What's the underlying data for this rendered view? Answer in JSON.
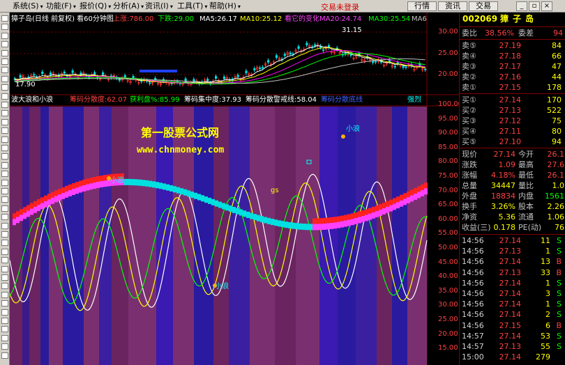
{
  "menubar": {
    "items": [
      {
        "label": "系统(S)"
      },
      {
        "label": "功能(F)"
      },
      {
        "label": "报价(Q)"
      },
      {
        "label": "分析(A)"
      },
      {
        "label": "资讯(I)"
      },
      {
        "label": "工具(T)"
      },
      {
        "label": "帮助(H)"
      }
    ],
    "account_status": "交易未登录",
    "buttons": [
      "行情",
      "资讯",
      "交易"
    ],
    "window_controls": [
      "minimize-icon",
      "restore-icon",
      "close-icon"
    ]
  },
  "colors": {
    "up": "#ff3030",
    "down": "#00e0e0",
    "ma5": "#ffffff",
    "ma10": "#ffff00",
    "ma20": "#ff00ff",
    "ma30": "#00ff00",
    "ma60": "#c0c0c0",
    "grid": "#800000",
    "watermark": "#ffff00",
    "menu_bg": "#d4d0c8"
  },
  "price_chart": {
    "title": "獐子岛(日线 前复权) 看60分钟图",
    "up_label": "上涨:786.00",
    "down_label": "下跌:29.00",
    "ma5": "MA5:26.17",
    "ma10": "MA10:25.12",
    "ma20": "看它的变化MA20:24.74",
    "ma30": "MA30:25.54",
    "ma60": "MA6",
    "high_marker": "31.15",
    "low_marker": "17.90",
    "y_ticks": [
      "30.00",
      "25.00",
      "20.00"
    ]
  },
  "indicator_chart": {
    "title": "波大浪和小浪",
    "param1": "筹码分散度:62.07",
    "param2": "获利盘%:85.99",
    "param3": "筹码集中度:37.93",
    "param4": "筹码分散警戒线:58.04",
    "param5": "筹码分散底线",
    "badge": "强烈",
    "y_ticks": [
      "100.00",
      "95.00",
      "90.00",
      "85.00",
      "80.00",
      "75.00",
      "70.00",
      "65.00",
      "60.00",
      "55.00",
      "50.00",
      "45.00",
      "40.00",
      "35.00",
      "30.00",
      "25.00",
      "20.00",
      "15.00"
    ],
    "annotations": [
      "小浪",
      "小浪",
      "小浪",
      "小浪",
      "gs"
    ],
    "watermark_title": "第一股票公式网",
    "watermark_url": "www.chnmoney.com"
  },
  "quote": {
    "code": "002069",
    "name": "獐子岛",
    "ratio_label": "委比",
    "ratio_value": "38.56%",
    "diff_label": "委差",
    "diff_value": "94",
    "asks": [
      {
        "label": "卖⑤",
        "price": "27.19",
        "vol": "84"
      },
      {
        "label": "卖④",
        "price": "27.18",
        "vol": "66"
      },
      {
        "label": "卖③",
        "price": "27.17",
        "vol": "47"
      },
      {
        "label": "卖②",
        "price": "27.16",
        "vol": "44"
      },
      {
        "label": "卖①",
        "price": "27.15",
        "vol": "178"
      }
    ],
    "bids": [
      {
        "label": "买①",
        "price": "27.14",
        "vol": "170"
      },
      {
        "label": "买②",
        "price": "27.13",
        "vol": "522"
      },
      {
        "label": "买③",
        "price": "27.12",
        "vol": "75"
      },
      {
        "label": "买④",
        "price": "27.11",
        "vol": "80"
      },
      {
        "label": "买⑤",
        "price": "27.10",
        "vol": "94"
      }
    ],
    "stats": [
      {
        "l1": "现价",
        "v1": "27.14",
        "l2": "今开",
        "v2": "26.1"
      },
      {
        "l1": "涨跌",
        "v1": "1.09",
        "l2": "最高",
        "v2": "27.6"
      },
      {
        "l1": "涨幅",
        "v1": "4.18%",
        "l2": "最低",
        "v2": "26.1"
      },
      {
        "l1": "总量",
        "v1": "34447",
        "l2": "量比",
        "v2": "1.0"
      },
      {
        "l1": "外盘",
        "v1": "18834",
        "l2": "内盘",
        "v2": "1561"
      },
      {
        "l1": "换手",
        "v1": "3.26%",
        "l2": "股本",
        "v2": "2.26"
      },
      {
        "l1": "净资",
        "v1": "5.36",
        "l2": "流通",
        "v2": "1.06"
      },
      {
        "l1": "收益(三)",
        "v1": "0.178",
        "l2": "PE(动)",
        "v2": "76"
      }
    ],
    "ticks": [
      {
        "time": "14:56",
        "price": "27.14",
        "vol": "11",
        "side": "S"
      },
      {
        "time": "14:56",
        "price": "27.13",
        "vol": "1",
        "side": "S"
      },
      {
        "time": "14:56",
        "price": "27.14",
        "vol": "13",
        "side": "B"
      },
      {
        "time": "14:56",
        "price": "27.13",
        "vol": "33",
        "side": "B"
      },
      {
        "time": "14:56",
        "price": "27.14",
        "vol": "1",
        "side": "S"
      },
      {
        "time": "14:56",
        "price": "27.14",
        "vol": "3",
        "side": "S"
      },
      {
        "time": "14:56",
        "price": "27.14",
        "vol": "1",
        "side": "S"
      },
      {
        "time": "14:56",
        "price": "27.14",
        "vol": "2",
        "side": "S"
      },
      {
        "time": "14:56",
        "price": "27.15",
        "vol": "6",
        "side": "B"
      },
      {
        "time": "14:57",
        "price": "27.14",
        "vol": "53",
        "side": "S"
      },
      {
        "time": "14:57",
        "price": "27.13",
        "vol": "55",
        "side": "S"
      },
      {
        "time": "15:00",
        "price": "27.14",
        "vol": "279",
        "side": ""
      }
    ]
  }
}
